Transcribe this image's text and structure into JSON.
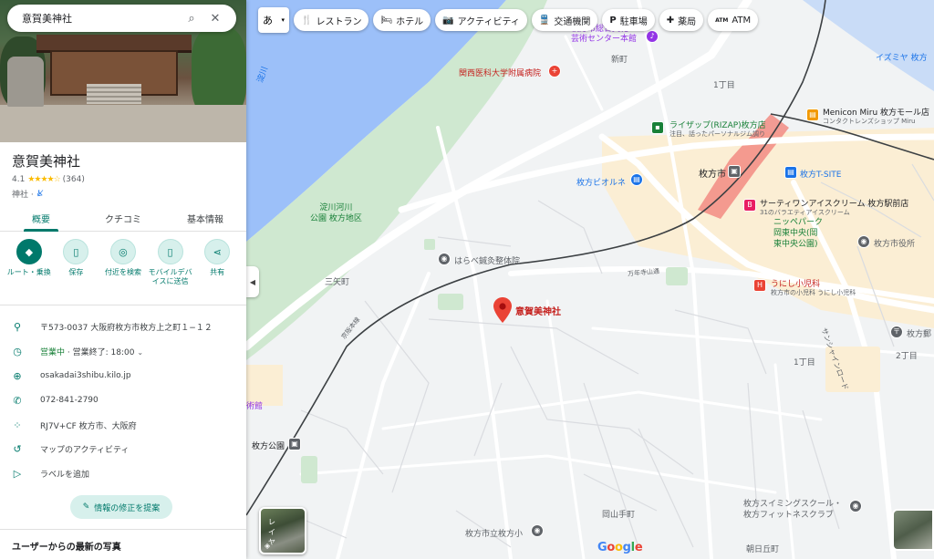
{
  "search": {
    "query": "意賀美神社"
  },
  "place": {
    "name": "意賀美神社",
    "rating": "4.1",
    "stars": "★★★★☆",
    "review_count": "(364)",
    "category": "神社 ·"
  },
  "tabs": [
    {
      "label": "概要"
    },
    {
      "label": "クチコミ"
    },
    {
      "label": "基本情報"
    }
  ],
  "actions": [
    {
      "label": "ルート・乗換",
      "icon": "◆"
    },
    {
      "label": "保存",
      "icon": "🔖"
    },
    {
      "label": "付近を検索",
      "icon": "◎"
    },
    {
      "label": "モバイルデバイスに送信",
      "icon": "▯"
    },
    {
      "label": "共有",
      "icon": "⋖"
    }
  ],
  "info": {
    "address": "〒573-0037 大阪府枚方市枚方上之町１−１２",
    "hours_status": "営業中",
    "hours_close": " · 営業終了: 18:00",
    "website": "osakadai3shibu.kilo.jp",
    "phone": "072-841-2790",
    "plus_code": "RJ7V+CF 枚方市、大阪府",
    "activity": "マップのアクティビティ",
    "label": "ラベルを追加"
  },
  "suggest_edit": "情報の修正を提案",
  "photos_heading": "ユーザーからの最新の写真",
  "chips": [
    {
      "label": "レストラン",
      "icon": "🍴"
    },
    {
      "label": "ホテル",
      "icon": "🛏"
    },
    {
      "label": "アクティビティ",
      "icon": "📷"
    },
    {
      "label": "交通機関",
      "icon": "🚆"
    },
    {
      "label": "駐車場",
      "icon": "P"
    },
    {
      "label": "薬局",
      "icon": "✚"
    },
    {
      "label": "ATM",
      "icon": "ATM"
    }
  ],
  "ime": "あ",
  "layers_label": "レイヤ",
  "google": "Google",
  "map_labels": {
    "hirakata_culture": "枚方市総合文化\n芸術センター本館",
    "kansai_hospital": "関西医科大学附属病院",
    "shinmachi": "新町",
    "itchome1": "1丁目",
    "rizap": "ライザップ(RIZAP)枚方店",
    "rizap_sub": "注目、話ったパーソナルジム調り",
    "meniconmiru": "Menicon Miru 枚方モール店",
    "meniconmiru_sub": "コンタクトレンズショップ Miru",
    "hirakatashi_station": "枚方市",
    "t_site": "枚方T-SITE",
    "viorne": "枚方ビオルネ",
    "thirtyone": "サーティワンアイスクリーム 枚方駅前店",
    "thirtyone_sub": "31のバラエティアイスクリーム",
    "yodogawa_park": "淀川河川\n公園 枚方地区",
    "nippe_park": "ニッペパーク\n岡東中央(岡\n東中央公園)",
    "city_office": "枚方市役所",
    "harabe": "はらべ鍼灸整体院",
    "sanyacho": "三矢町",
    "shrine_pin": "意賀美神社",
    "kuzuha_rd": "万年寺山通",
    "unishi": "うにし小児科",
    "unishi_sub": "枚方市の小児科 うにし小児科",
    "sunshine_rd": "サンシャインロード",
    "hirakata_post": "枚方郵",
    "itchome1b": "1丁目",
    "nichome2": "2丁目",
    "keihan_line": "京阪本線",
    "art_museum": "術館",
    "hirakata_koen": "枚方公園",
    "swimming": "枚方スイミングスクール・\n枚方フィットネスクラブ",
    "okayamate": "岡山手町",
    "asahigaoka": "朝日丘町",
    "hirakata_school": "枚方市立枚方小",
    "yodogawa": "淀川",
    "isumiya": "イズミヤ 枚方"
  },
  "colors": {
    "accent": "#00796b",
    "pin": "#ea4335",
    "water": "#9cc0f9",
    "park": "#c8e6c9"
  }
}
